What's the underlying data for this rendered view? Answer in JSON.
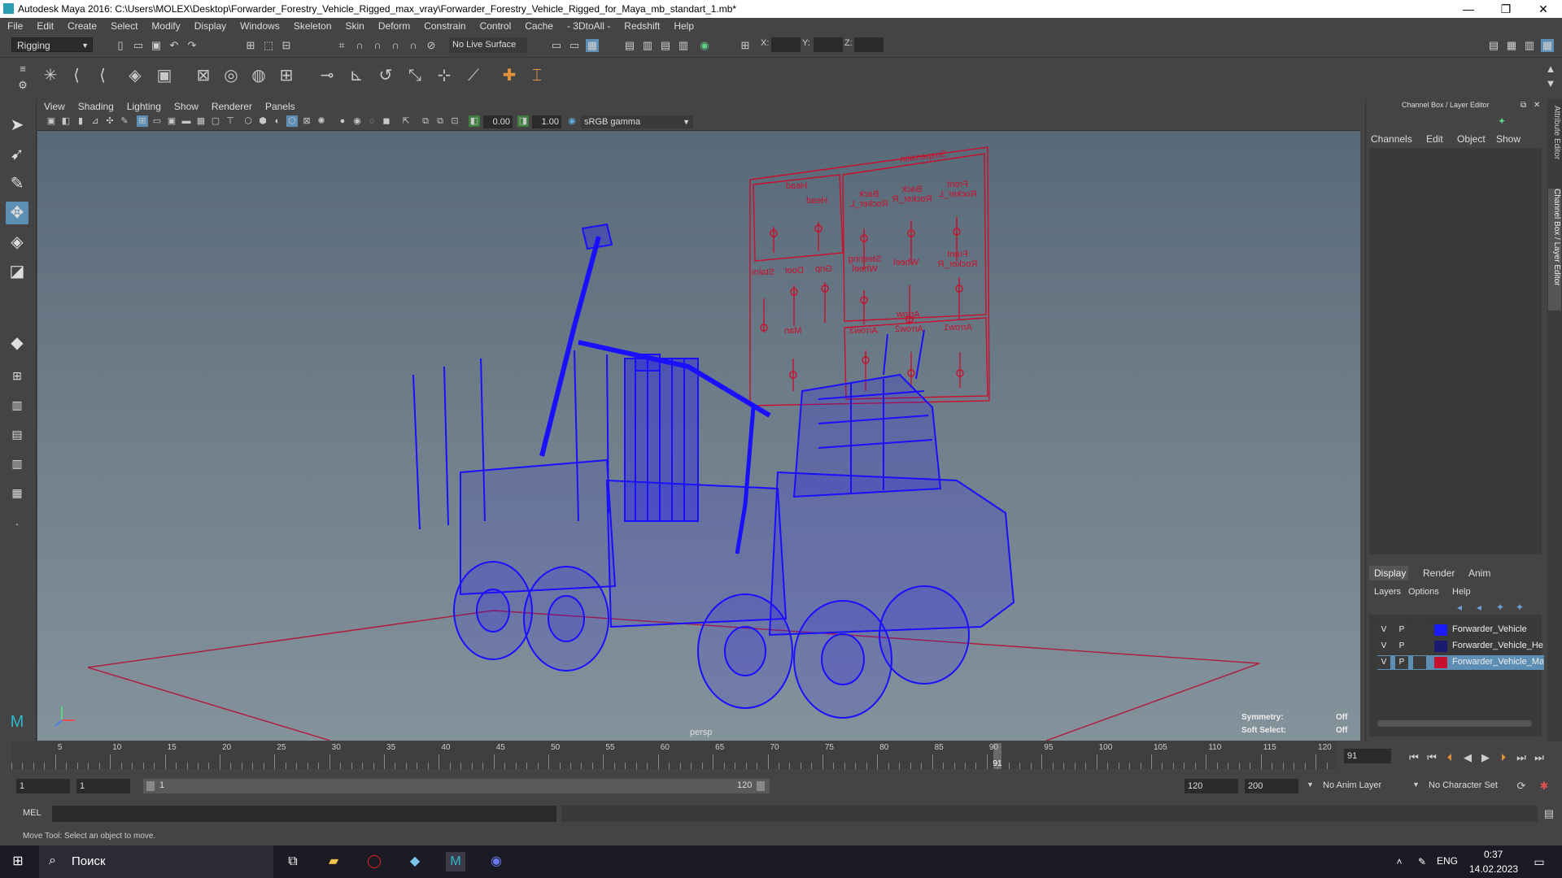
{
  "window": {
    "title": "Autodesk Maya 2016: C:\\Users\\MOLEX\\Desktop\\Forwarder_Forestry_Vehicle_Rigged_max_vray\\Forwarder_Forestry_Vehicle_Rigged_for_Maya_mb_standart_1.mb*",
    "minimize": "—",
    "restore": "❐",
    "close": "✕"
  },
  "menu": [
    "File",
    "Edit",
    "Create",
    "Select",
    "Modify",
    "Display",
    "Windows",
    "Skeleton",
    "Skin",
    "Deform",
    "Constrain",
    "Control",
    "Cache",
    "- 3DtoAll -",
    "Redshift",
    "Help"
  ],
  "statusline": {
    "mode": "Rigging",
    "live_surface": "No Live Surface",
    "x_label": "X:",
    "y_label": "Y:",
    "z_label": "Z:"
  },
  "viewport": {
    "menu": [
      "View",
      "Shading",
      "Lighting",
      "Show",
      "Renderer",
      "Panels"
    ],
    "exposure": "0.00",
    "gamma_value": "1.00",
    "color_space": "sRGB gamma",
    "camera": "persp",
    "hud": {
      "symmetry_label": "Symmetry:",
      "symmetry_value": "Off",
      "softselect_label": "Soft Select:",
      "softselect_value": "Off"
    }
  },
  "controls_board": {
    "labels": [
      "Suspension",
      "Head",
      "Head",
      "Back Rocker_L",
      "Back Rocker_R",
      "Front Rocker_L",
      "Stairs",
      "Door",
      "Grip",
      "Steering Wheel",
      "Wheel",
      "Front Rocker_R",
      "Man",
      "Arrow3",
      "Arrow2",
      "Arrow1",
      "Arrow"
    ]
  },
  "channelbox": {
    "title": "Channel Box / Layer Editor",
    "menu": [
      "Channels",
      "Edit",
      "Object",
      "Show"
    ],
    "layer_tabs": [
      "Display",
      "Render",
      "Anim"
    ],
    "layer_menu": [
      "Layers",
      "Options",
      "Help"
    ],
    "layers": [
      {
        "v": "V",
        "p": "P",
        "name": "Forwarder_Vehicle",
        "color": "#1a1aff"
      },
      {
        "v": "V",
        "p": "P",
        "name": "Forwarder_Vehicle_Helpers",
        "color": "#1a1a70"
      },
      {
        "v": "V",
        "p": "P",
        "name": "Forwarder_Vehicle_Manipulators",
        "color": "#c8102e"
      }
    ],
    "side_tabs": [
      "Attribute Editor",
      "Channel Box / Layer Editor"
    ]
  },
  "timeslider": {
    "ticks": [
      "5",
      "10",
      "15",
      "20",
      "25",
      "30",
      "35",
      "40",
      "45",
      "50",
      "55",
      "60",
      "65",
      "70",
      "75",
      "80",
      "85",
      "90",
      "95",
      "100",
      "105",
      "110",
      "115",
      "120"
    ],
    "current_frame": "91",
    "current_field": "91"
  },
  "range": {
    "start": "1",
    "start_inner": "1",
    "range_start_label": "1",
    "range_end_label": "120",
    "end_inner": "120",
    "end": "200",
    "anim_layer": "No Anim Layer",
    "char_set": "No Character Set"
  },
  "cmdline": {
    "lang": "MEL"
  },
  "helpline": {
    "text": "Move Tool: Select an object to move."
  },
  "taskbar": {
    "search": "Поиск",
    "lang": "ENG",
    "time": "0:37",
    "date": "14.02.2023"
  },
  "colors": {
    "wire": "#1a10ff",
    "board": "#c8102e",
    "grid_line": "#b01a3a",
    "accent": "#5d8fb5"
  }
}
